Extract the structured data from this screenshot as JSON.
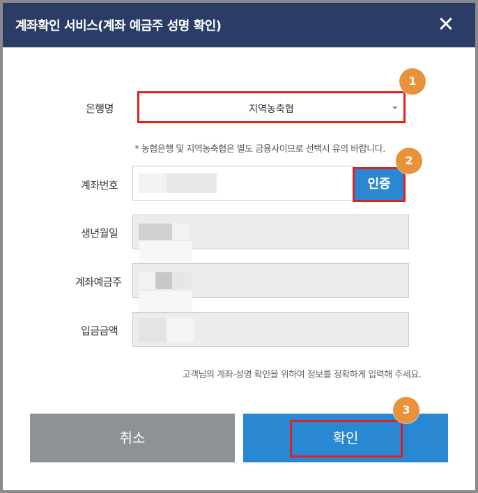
{
  "dialog": {
    "title": "계좌확인 서비스(계좌 예금주 성명 확인)",
    "close_symbol": "✕"
  },
  "form": {
    "bank_label": "은행명",
    "bank_selected": "지역농축협",
    "bank_chevron": "⌄",
    "notice": "* 농협은행 및 지역농축협은 별도 금융사이므로 선택시 유의 바랍니다.",
    "account_label": "계좌번호",
    "auth_button": "인증",
    "birth_label": "생년월일",
    "holder_label": "계좌예금주",
    "deposit_label": "입금금액",
    "guide": "고객님의 계좌-성명 확인을 위하여 정보를 정확하게 입력해 주세요."
  },
  "actions": {
    "cancel_label": "취소",
    "confirm_label": "확인"
  },
  "markers": [
    "1",
    "2",
    "3"
  ],
  "colors": {
    "header": "#2b3d66",
    "primary": "#2a88d2",
    "cancel": "#8e9296",
    "highlight": "#e02020",
    "marker": "#e8923a"
  },
  "icons": {
    "close": "close-icon",
    "select": "chevron-down-icon"
  }
}
